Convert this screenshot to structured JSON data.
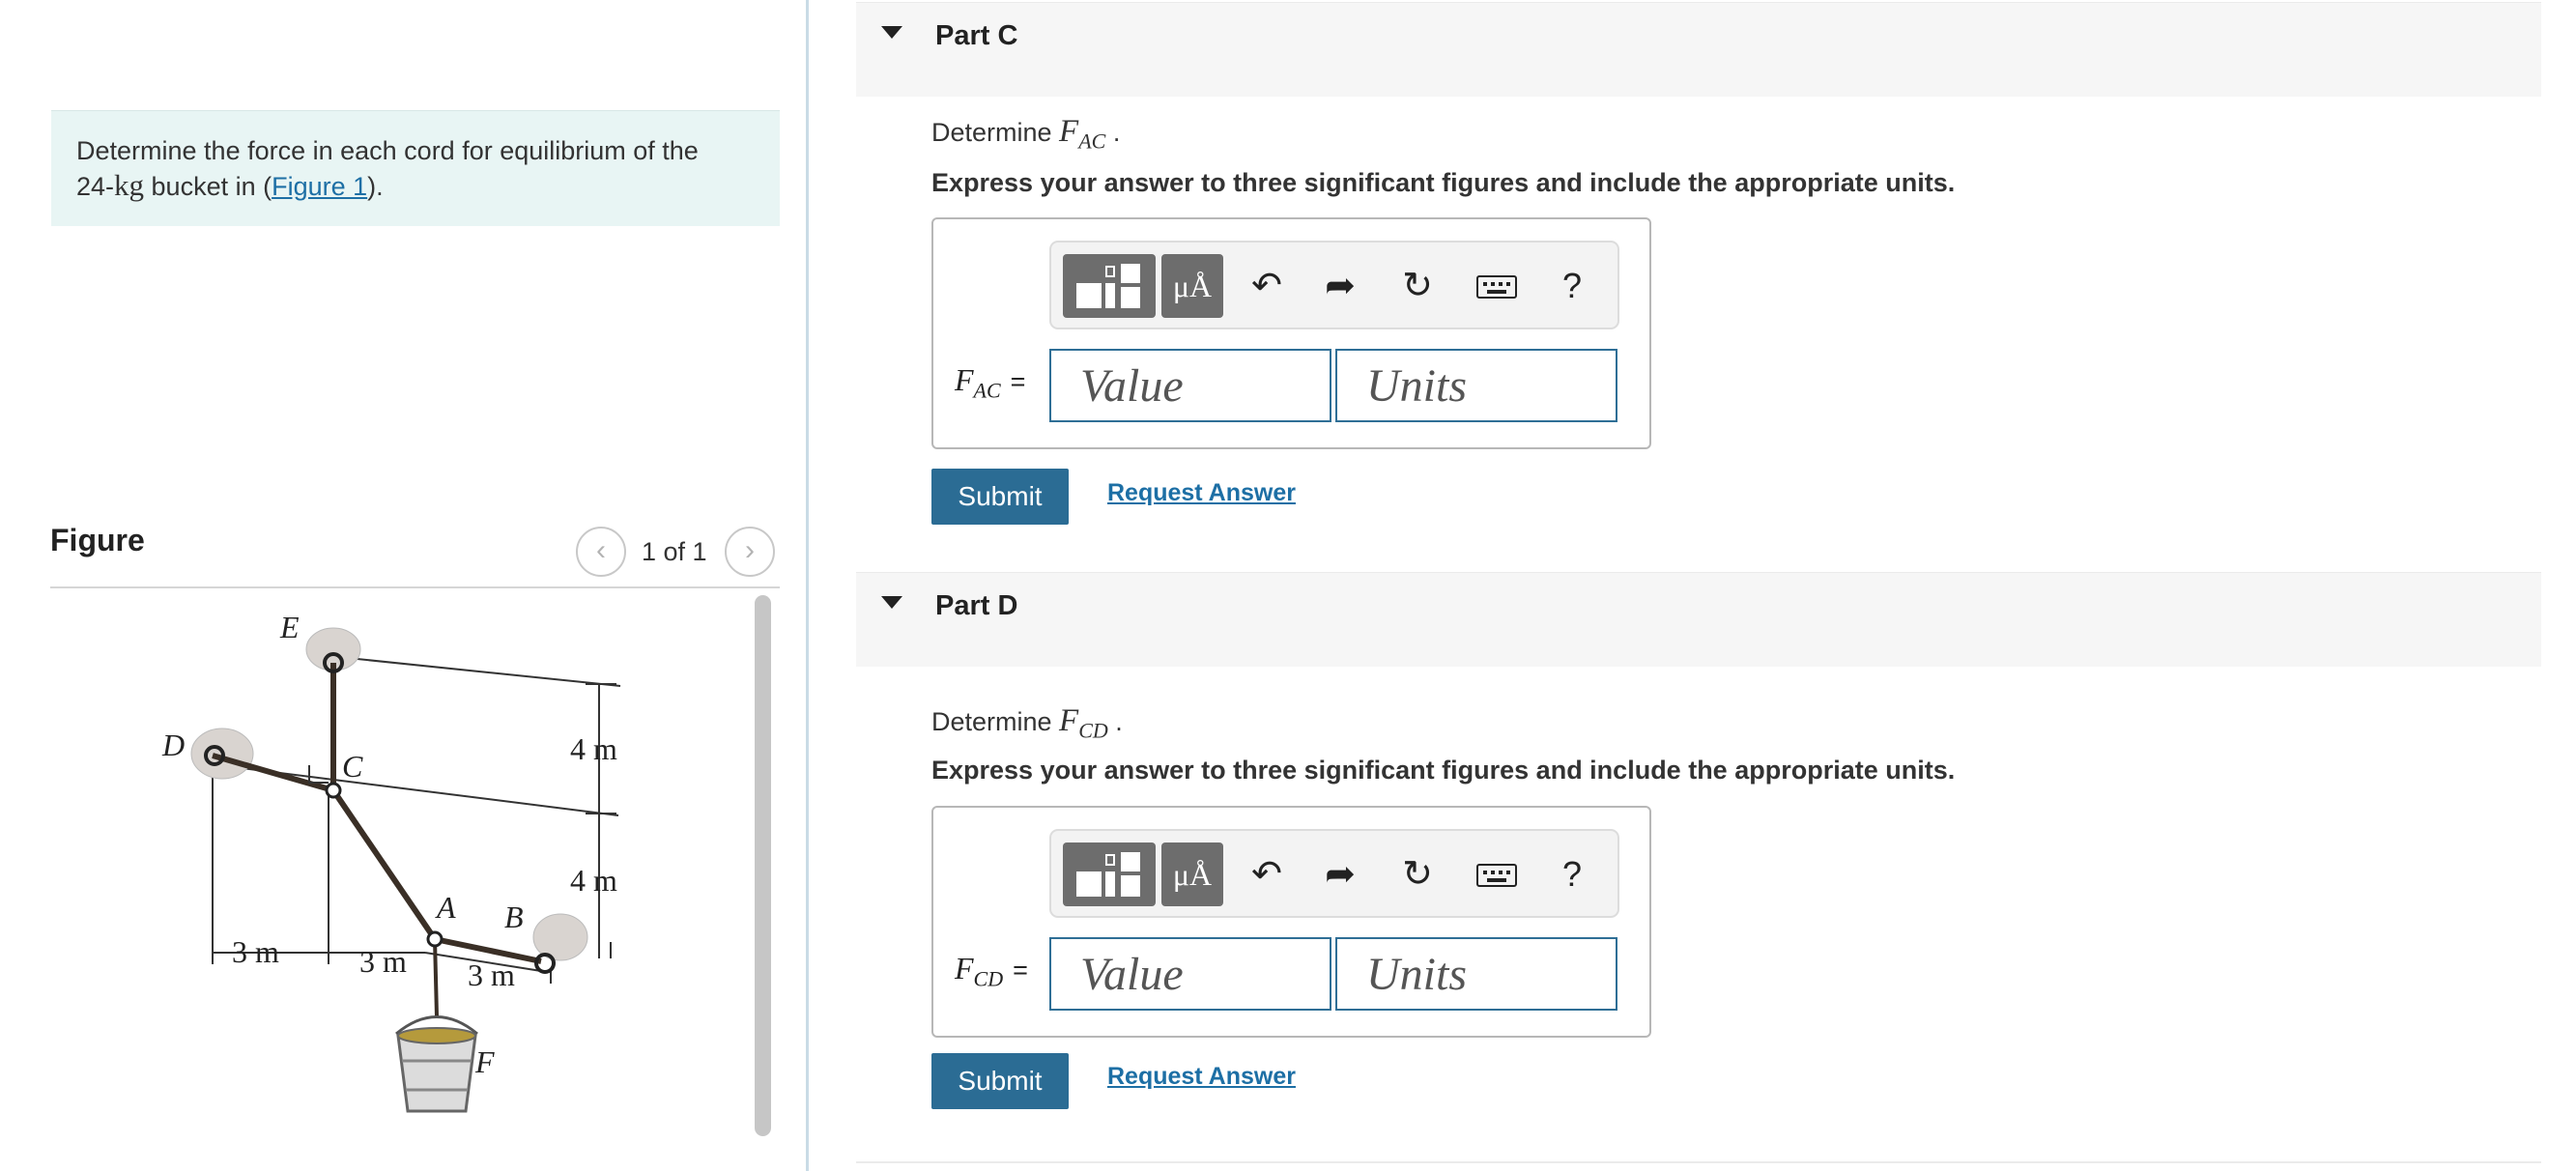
{
  "problem": {
    "text_before": "Determine the force in each cord for equilibrium of the",
    "mass_value": "24-",
    "mass_unit": "kg",
    "text_middle": " bucket in (",
    "figure_link": "Figure 1",
    "text_after": ")."
  },
  "figure": {
    "heading": "Figure",
    "pager": {
      "prev_icon": "chevron-left-icon",
      "next_icon": "chevron-right-icon",
      "count": "1 of 1"
    },
    "labels": {
      "E": "E",
      "D": "D",
      "C": "C",
      "A": "A",
      "B": "B",
      "F": "F",
      "dim_4m_upper": "4 m",
      "dim_4m_lower": "4 m",
      "dim_3m_left": "3 m",
      "dim_3m_middle": "3 m",
      "dim_3m_right": "3 m"
    }
  },
  "parts": [
    {
      "title": "Part C",
      "determine_prefix": "Determine ",
      "symbol": "F",
      "subscript": "AC",
      "determine_suffix": " .",
      "instructions": "Express your answer to three significant figures and include the appropriate units.",
      "toolbar": {
        "units_label": "μÅ",
        "undo_icon": "undo-icon",
        "redo_icon": "redo-icon",
        "reset_icon": "reset-icon",
        "keyboard_icon": "keyboard-icon",
        "help_label": "?"
      },
      "var_symbol": "F",
      "var_subscript": "AC",
      "equals": "=",
      "value_placeholder": "Value",
      "units_placeholder": "Units",
      "submit_label": "Submit",
      "request_label": "Request Answer"
    },
    {
      "title": "Part D",
      "determine_prefix": "Determine ",
      "symbol": "F",
      "subscript": "CD",
      "determine_suffix": " .",
      "instructions": "Express your answer to three significant figures and include the appropriate units.",
      "toolbar": {
        "units_label": "μÅ",
        "undo_icon": "undo-icon",
        "redo_icon": "redo-icon",
        "reset_icon": "reset-icon",
        "keyboard_icon": "keyboard-icon",
        "help_label": "?"
      },
      "var_symbol": "F",
      "var_subscript": "CD",
      "equals": "=",
      "value_placeholder": "Value",
      "units_placeholder": "Units",
      "submit_label": "Submit",
      "request_label": "Request Answer"
    }
  ],
  "colors": {
    "accent": "#2b6c94",
    "link": "#1d6fa5",
    "problem_bg": "#e8f5f4",
    "header_bg": "#f6f6f6"
  }
}
